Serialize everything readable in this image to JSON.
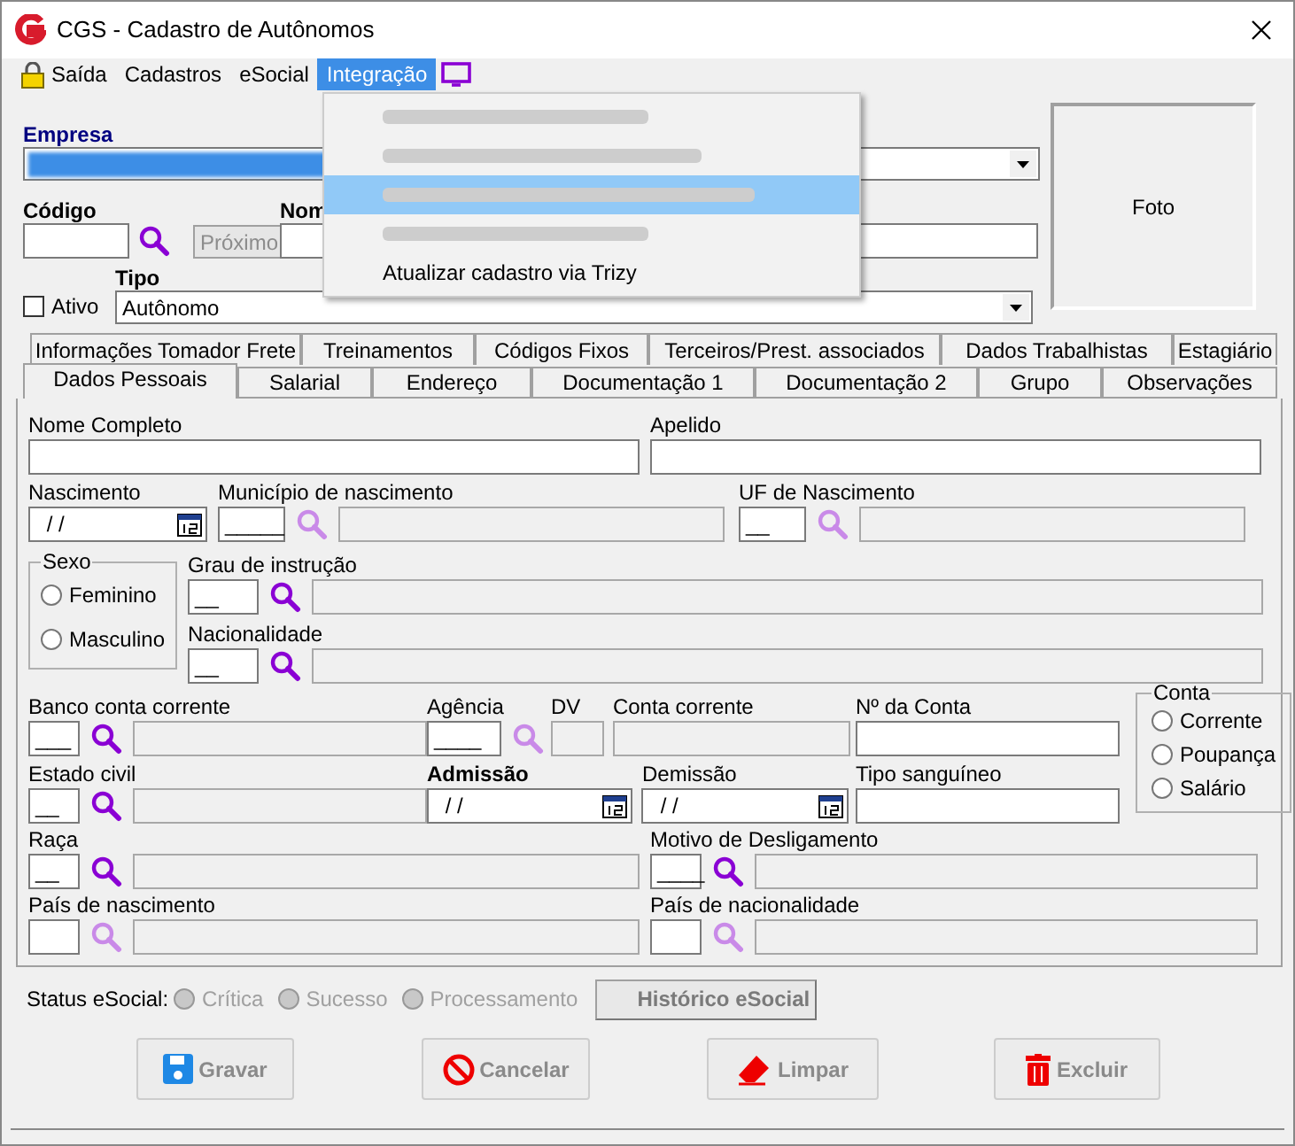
{
  "window": {
    "title": "CGS - Cadastro de Autônomos"
  },
  "menu": [
    {
      "label": "Saída",
      "selected": false,
      "kind": "lock"
    },
    {
      "label": "Cadastros",
      "selected": false
    },
    {
      "label": "eSocial",
      "selected": false
    },
    {
      "label": "Integração",
      "selected": true
    }
  ],
  "dropdown": [
    {
      "kind": "redacted",
      "disabled": true,
      "selected": false
    },
    {
      "kind": "redacted",
      "disabled": true,
      "selected": false
    },
    {
      "kind": "redacted",
      "disabled": true,
      "selected": true
    },
    {
      "kind": "redacted",
      "disabled": true,
      "selected": false
    },
    {
      "label": "Atualizar cadastro via Trizy",
      "disabled": false,
      "selected": false
    }
  ],
  "header": {
    "empresa_label": "Empresa",
    "codigo_label": "Código",
    "next_button": "Próximo",
    "nome_label": "Nom",
    "ativo": {
      "label": "Ativo",
      "checked": false
    },
    "tipo_label": "Tipo",
    "tipo_value": "Autônomo",
    "photo_label": "Foto"
  },
  "tabs_back": [
    {
      "label": "Informações Tomador Frete",
      "selected": false
    },
    {
      "label": "Treinamentos",
      "selected": false
    },
    {
      "label": "Códigos Fixos",
      "selected": false
    },
    {
      "label": "Terceiros/Prest. associados",
      "selected": false
    },
    {
      "label": "Dados Trabalhistas",
      "selected": false
    },
    {
      "label": "Estagiário",
      "selected": false
    }
  ],
  "tabs_front": [
    {
      "label": "Dados Pessoais",
      "selected": true
    },
    {
      "label": "Salarial",
      "selected": false
    },
    {
      "label": "Endereço",
      "selected": false
    },
    {
      "label": "Documentação 1",
      "selected": false
    },
    {
      "label": "Documentação 2",
      "selected": false
    },
    {
      "label": "Grupo",
      "selected": false
    },
    {
      "label": "Observações",
      "selected": false
    }
  ],
  "fields": {
    "nome_completo": {
      "label": "Nome Completo"
    },
    "apelido": {
      "label": "Apelido"
    },
    "nascimento": {
      "label": "Nascimento",
      "value": " / /"
    },
    "municipio": {
      "label": "Município de nascimento",
      "value": "_____",
      "lookup_enabled": false
    },
    "uf": {
      "label": "UF de Nascimento",
      "value": "__",
      "lookup_enabled": false
    },
    "grau": {
      "label": "Grau de instrução",
      "value": "__",
      "lookup_enabled": true
    },
    "nacionalidade": {
      "label": "Nacionalidade",
      "value": "__",
      "lookup_enabled": true
    },
    "banco": {
      "label": "Banco conta corrente",
      "value": "___",
      "lookup_enabled": true
    },
    "agencia": {
      "label": "Agência",
      "value": "____",
      "lookup_enabled": false
    },
    "dv": {
      "label": "DV"
    },
    "conta_corrente": {
      "label": "Conta corrente"
    },
    "numero_conta": {
      "label": "Nº da Conta"
    },
    "estado_civil": {
      "label": "Estado civil",
      "value": "__",
      "lookup_enabled": true
    },
    "admissao": {
      "label": "Admissão",
      "value": " / /"
    },
    "demissao": {
      "label": "Demissão",
      "value": " / /"
    },
    "tipo_sanguineo": {
      "label": "Tipo sanguíneo"
    },
    "raca": {
      "label": "Raça",
      "value": "__",
      "lookup_enabled": true
    },
    "motivo": {
      "label": "Motivo de Desligamento",
      "value": "____",
      "lookup_enabled": true
    },
    "pais_nascimento": {
      "label": "País de nascimento",
      "lookup_enabled": false
    },
    "pais_nacionalidade": {
      "label": "País de nacionalidade",
      "lookup_enabled": false
    }
  },
  "sexo": {
    "label": "Sexo",
    "options": [
      {
        "label": "Feminino",
        "selected": false
      },
      {
        "label": "Masculino",
        "selected": false
      }
    ]
  },
  "conta": {
    "label": "Conta",
    "options": [
      {
        "label": "Corrente",
        "selected": false
      },
      {
        "label": "Poupança",
        "selected": false
      },
      {
        "label": "Salário",
        "selected": false
      }
    ]
  },
  "status_esocial": {
    "label": "Status eSocial:",
    "options": [
      {
        "label": "Crítica",
        "disabled": true,
        "selected": false
      },
      {
        "label": "Sucesso",
        "disabled": true,
        "selected": false
      },
      {
        "label": "Processamento",
        "disabled": true,
        "selected": false
      }
    ],
    "history_button": "Histórico eSocial"
  },
  "buttons": [
    {
      "label": "Gravar",
      "kind": "save"
    },
    {
      "label": "Cancelar",
      "kind": "cancel"
    },
    {
      "label": "Limpar",
      "kind": "clear"
    },
    {
      "label": "Excluir",
      "kind": "delete"
    }
  ]
}
